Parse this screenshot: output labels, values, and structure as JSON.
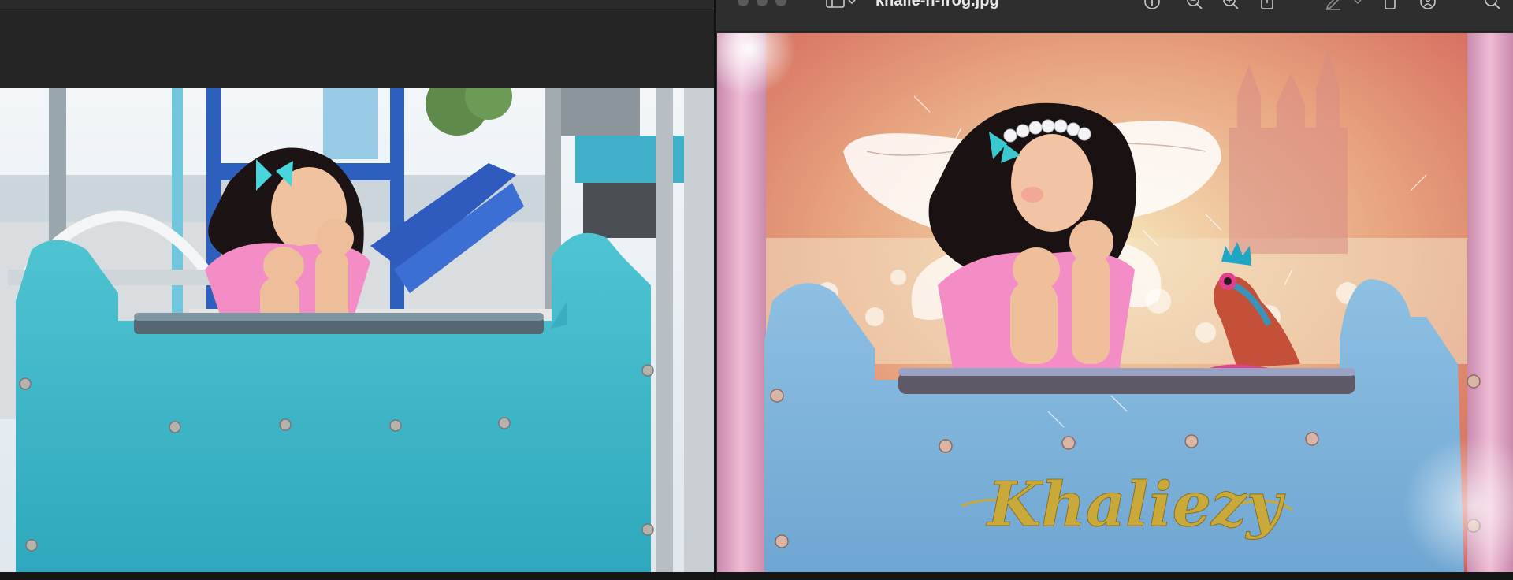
{
  "preview_window": {
    "document_title": "khalie-n-frog.jpg",
    "toolbar_icons": [
      "sidebar-icon",
      "chevron-down-icon",
      "info-icon",
      "zoom-out-icon",
      "zoom-in-icon",
      "share-icon",
      "markup-icon",
      "chevron-down-icon",
      "rotate-icon",
      "accessibility-icon",
      "search-icon"
    ]
  },
  "edited_photo": {
    "name_text": "Khaliezy"
  },
  "colors": {
    "sign_teal": "#3cb8c8",
    "sign_blue": "#86b9dc",
    "frame_pink": "#e3a9c7",
    "dress_pink": "#f48cc6",
    "name_gold": "#c9a93a"
  }
}
